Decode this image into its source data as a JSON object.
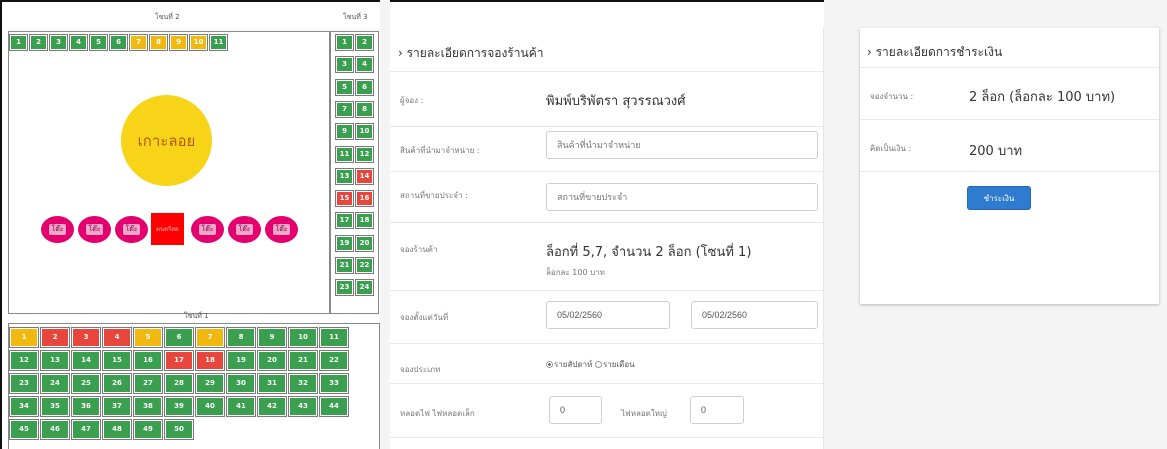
{
  "map": {
    "zone2_label": "โซนที่ 2",
    "zone3_label": "โซนที่ 3",
    "zone1_label": "โซนที่ 1",
    "island_label": "เกาะลอย",
    "table_label": "โต๊ะ",
    "music_label": "ดนตรีสด",
    "zone2_top": [
      {
        "n": "1",
        "s": "g"
      },
      {
        "n": "2",
        "s": "g"
      },
      {
        "n": "3",
        "s": "g"
      },
      {
        "n": "4",
        "s": "g"
      },
      {
        "n": "5",
        "s": "g"
      },
      {
        "n": "6",
        "s": "g"
      },
      {
        "n": "7",
        "s": "y"
      },
      {
        "n": "8",
        "s": "y"
      },
      {
        "n": "9",
        "s": "y"
      },
      {
        "n": "10",
        "s": "y"
      },
      {
        "n": "11",
        "s": "g"
      }
    ],
    "zone3_cells": [
      {
        "n": "1",
        "s": "g"
      },
      {
        "n": "2",
        "s": "g"
      },
      {
        "n": "3",
        "s": "g"
      },
      {
        "n": "4",
        "s": "g"
      },
      {
        "n": "5",
        "s": "g"
      },
      {
        "n": "6",
        "s": "g"
      },
      {
        "n": "7",
        "s": "g"
      },
      {
        "n": "8",
        "s": "g"
      },
      {
        "n": "9",
        "s": "g"
      },
      {
        "n": "10",
        "s": "g"
      },
      {
        "n": "11",
        "s": "g"
      },
      {
        "n": "12",
        "s": "g"
      },
      {
        "n": "13",
        "s": "g"
      },
      {
        "n": "14",
        "s": "r"
      },
      {
        "n": "15",
        "s": "r"
      },
      {
        "n": "16",
        "s": "r"
      },
      {
        "n": "17",
        "s": "g"
      },
      {
        "n": "18",
        "s": "g"
      },
      {
        "n": "19",
        "s": "g"
      },
      {
        "n": "20",
        "s": "g"
      },
      {
        "n": "21",
        "s": "g"
      },
      {
        "n": "22",
        "s": "g"
      },
      {
        "n": "23",
        "s": "g"
      },
      {
        "n": "24",
        "s": "g"
      }
    ],
    "zone1_cells": [
      {
        "n": "1",
        "s": "y"
      },
      {
        "n": "2",
        "s": "r"
      },
      {
        "n": "3",
        "s": "r"
      },
      {
        "n": "4",
        "s": "r"
      },
      {
        "n": "5",
        "s": "y"
      },
      {
        "n": "6",
        "s": "g"
      },
      {
        "n": "7",
        "s": "y"
      },
      {
        "n": "8",
        "s": "g"
      },
      {
        "n": "9",
        "s": "g"
      },
      {
        "n": "10",
        "s": "g"
      },
      {
        "n": "11",
        "s": "g"
      },
      {
        "n": "12",
        "s": "g"
      },
      {
        "n": "13",
        "s": "g"
      },
      {
        "n": "14",
        "s": "g"
      },
      {
        "n": "15",
        "s": "g"
      },
      {
        "n": "16",
        "s": "g"
      },
      {
        "n": "17",
        "s": "r"
      },
      {
        "n": "18",
        "s": "r"
      },
      {
        "n": "19",
        "s": "g"
      },
      {
        "n": "20",
        "s": "g"
      },
      {
        "n": "21",
        "s": "g"
      },
      {
        "n": "22",
        "s": "g"
      },
      {
        "n": "23",
        "s": "g"
      },
      {
        "n": "24",
        "s": "g"
      },
      {
        "n": "25",
        "s": "g"
      },
      {
        "n": "26",
        "s": "g"
      },
      {
        "n": "27",
        "s": "g"
      },
      {
        "n": "28",
        "s": "g"
      },
      {
        "n": "29",
        "s": "g"
      },
      {
        "n": "30",
        "s": "g"
      },
      {
        "n": "31",
        "s": "g"
      },
      {
        "n": "32",
        "s": "g"
      },
      {
        "n": "33",
        "s": "g"
      },
      {
        "n": "34",
        "s": "g"
      },
      {
        "n": "35",
        "s": "g"
      },
      {
        "n": "36",
        "s": "g"
      },
      {
        "n": "37",
        "s": "g"
      },
      {
        "n": "38",
        "s": "g"
      },
      {
        "n": "39",
        "s": "g"
      },
      {
        "n": "40",
        "s": "g"
      },
      {
        "n": "41",
        "s": "g"
      },
      {
        "n": "42",
        "s": "g"
      },
      {
        "n": "43",
        "s": "g"
      },
      {
        "n": "44",
        "s": "g"
      },
      {
        "n": "45",
        "s": "g"
      },
      {
        "n": "46",
        "s": "g"
      },
      {
        "n": "47",
        "s": "g"
      },
      {
        "n": "48",
        "s": "g"
      },
      {
        "n": "49",
        "s": "g"
      },
      {
        "n": "50",
        "s": "g"
      }
    ],
    "status_colors": {
      "available": "#3aa050",
      "pending": "#f1b90f",
      "booked": "#e8453c"
    }
  },
  "booking": {
    "title": "› รายละเอียดการจองร้านค้า",
    "booker_label": "ผู้จอง :",
    "booker_name": "พิมพ์บริพัตรา สุวรรณวงศ์",
    "product_label": "สินค้าที่นำมาจำหน่าย :",
    "product_placeholder": "สินค้าที่นำมาจำหน่าย",
    "location_label": "สถานที่ขายประจำ :",
    "location_placeholder": "สถานที่ขายประจำ",
    "stall_label": "จองร้านค้า",
    "stall_value": "ล็อกที่ 5,7, จำนวน 2 ล็อก (โซนที่ 1)",
    "stall_price": "ล็อกละ 100 บาท",
    "date_label": "จองตั้งแต่วันที่",
    "date_from": "05/02/2560",
    "date_to": "05/02/2560",
    "type_label": "จองประเภท",
    "type_weekly": "รายสัปดาห์",
    "type_monthly": "รายเดือน",
    "bulb_label": "หลอดไฟ ไฟหลอดเล็ก",
    "bulb_small_value": "0",
    "bulb_large_label": "ไฟหลอดใหญ่",
    "bulb_large_value": "0"
  },
  "payment": {
    "title": "› รายละเอียดการชำระเงิน",
    "qty_label": "จองจำนวน :",
    "qty_value": "2 ล็อก (ล็อกละ 100 บาท)",
    "total_label": "คิดเป็นเงิน :",
    "total_value": "200 บาท",
    "pay_button": "ชำระเงิน"
  }
}
